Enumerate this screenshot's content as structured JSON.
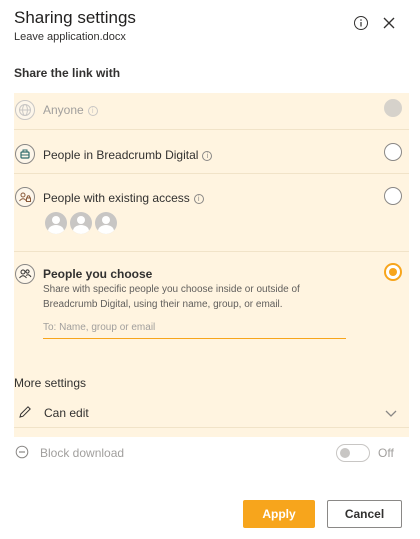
{
  "header": {
    "title": "Sharing settings",
    "subtitle": "Leave application.docx",
    "info_icon": "info-circle-icon",
    "close_icon": "close-icon"
  },
  "share_section": {
    "label": "Share the link with",
    "options": [
      {
        "label": "Anyone",
        "icon": "globe-icon",
        "state": "disabled"
      },
      {
        "label": "People in Breadcrumb Digital",
        "icon": "organization-icon",
        "state": "unselected"
      },
      {
        "label": "People with existing access",
        "icon": "people-lock-icon",
        "state": "unselected"
      },
      {
        "label": "People you choose",
        "icon": "people-icon",
        "state": "selected",
        "description": "Share with specific people you choose inside or outside of Breadcrumb Digital, using their name, group, or email.",
        "input_placeholder": "To: Name, group or email",
        "input_value": ""
      }
    ]
  },
  "more_settings": {
    "label": "More settings",
    "permission": "Can edit",
    "block_download_label": "Block download",
    "block_download_state": "Off"
  },
  "footer": {
    "apply_label": "Apply",
    "cancel_label": "Cancel"
  },
  "colors": {
    "accent": "#f7a51c",
    "panel_bg": "#fff4e0"
  }
}
